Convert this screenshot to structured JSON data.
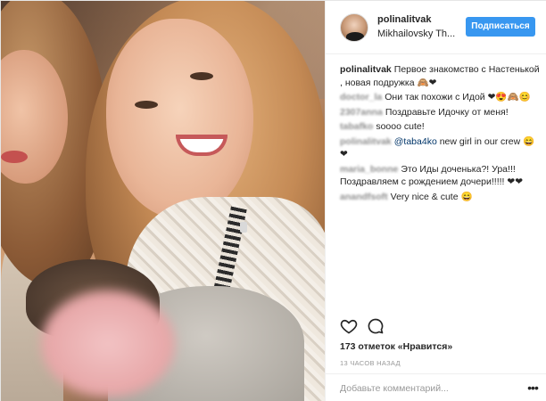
{
  "post": {
    "username": "polinalitvak",
    "location": "Mikhailovsky Th...",
    "follow_label": "Подписаться",
    "photo_icon": "photo-of-women-with-baby"
  },
  "comments": [
    {
      "author": "polinalitvak",
      "text": "Первое знакомство с Настенькой , новая подружка 🙈❤",
      "blurred": false
    },
    {
      "author": "doctor_la",
      "text": "Они так похожи с Идой ❤😍🙈😊",
      "blurred": true
    },
    {
      "author": "2307anna",
      "text": "Поздравьте Идочку от меня!",
      "blurred": true
    },
    {
      "author": "tabafko",
      "text": "soooo cute!",
      "blurred": true
    },
    {
      "author": "polinalitvak",
      "mention": "@taba4ko",
      "text": " new girl in our crew 😄 ❤",
      "blurred": true
    },
    {
      "author": "maria_bonne",
      "text": "Это Иды доченька?! Ура!!! Поздравляем с рождением дочери!!!!! ❤❤",
      "blurred": true
    },
    {
      "author": "anandfsoft",
      "text": "Very nice & cute 😄",
      "blurred": true
    }
  ],
  "actions": {
    "like_icon": "heart-icon",
    "comment_icon": "speech-bubble-icon",
    "more_icon": "more-dots-icon",
    "more_glyph": "•••"
  },
  "likes_text": "173 отметок «Нравится»",
  "time_text": "13 ЧАСОВ НАЗАД",
  "add_comment_placeholder": "Добавьте комментарий...",
  "colors": {
    "accent": "#3897f0",
    "text": "#262626",
    "muted": "#999999",
    "mention": "#003569"
  }
}
